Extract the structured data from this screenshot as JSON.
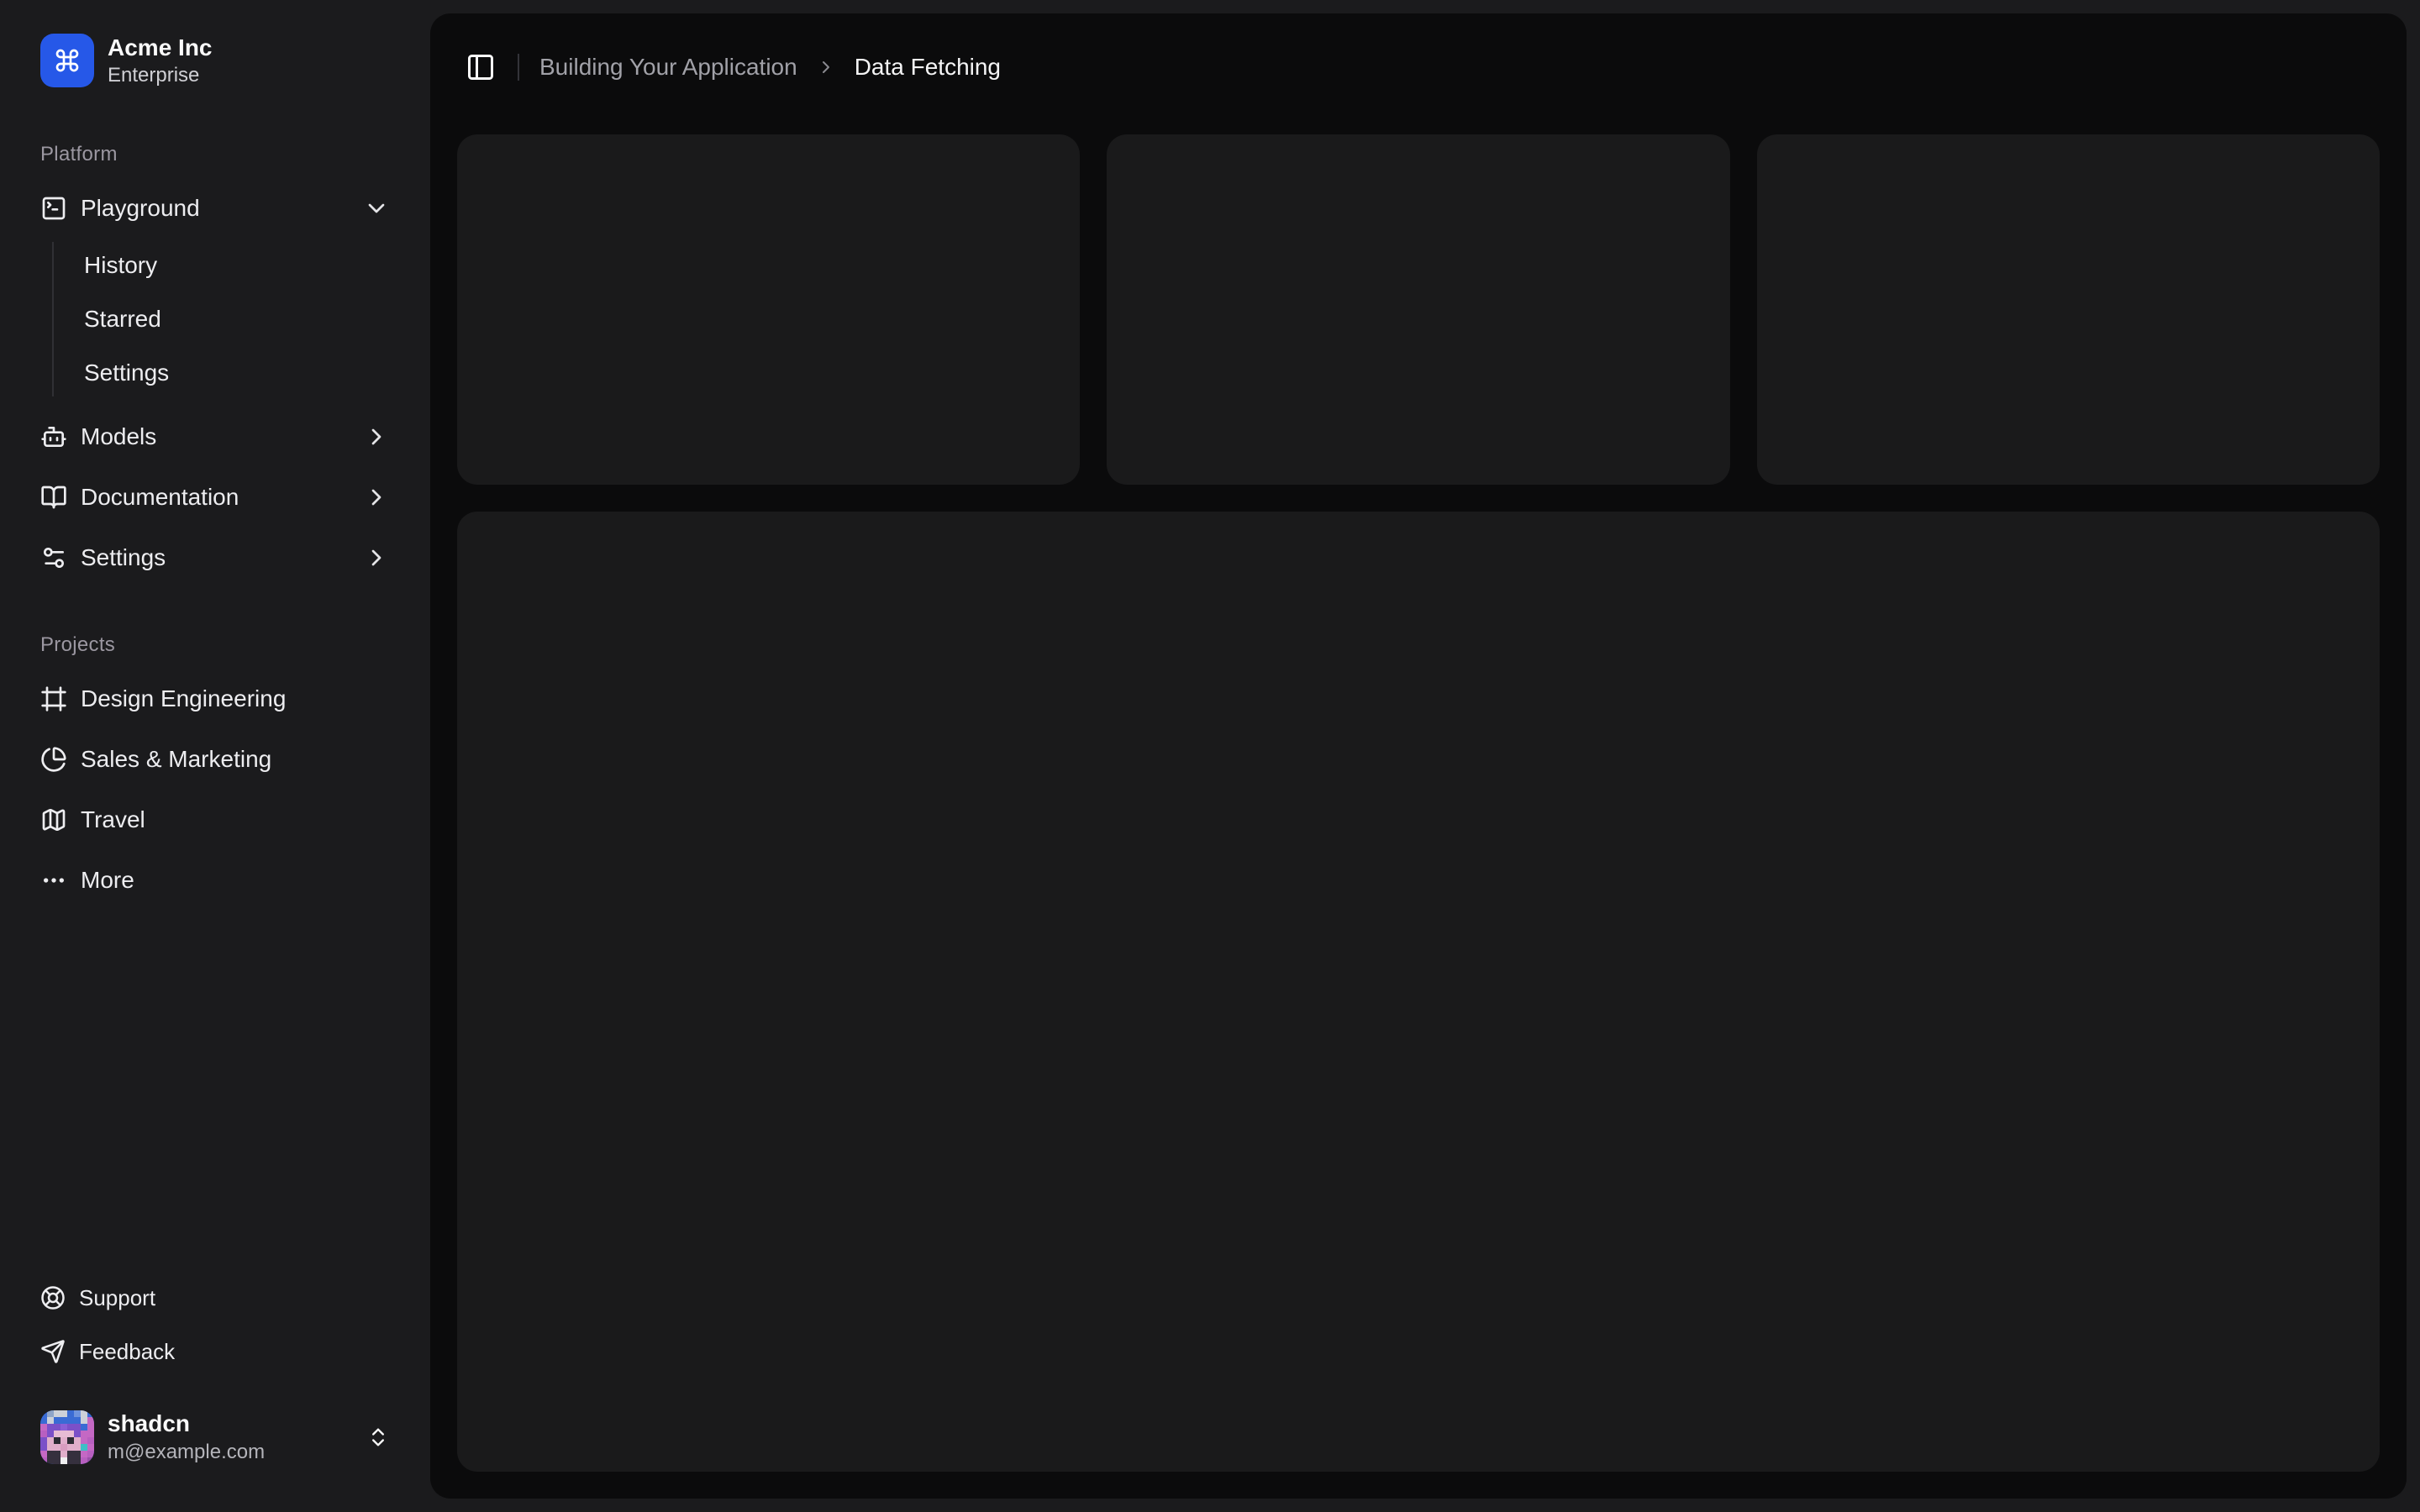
{
  "team": {
    "name": "Acme Inc",
    "plan": "Enterprise",
    "logo_icon": "command-icon",
    "logo_color": "#2658e8"
  },
  "sidebar": {
    "platform": {
      "label": "Platform",
      "playground": {
        "label": "Playground",
        "icon": "square-terminal-icon",
        "state": "expanded",
        "children": [
          {
            "label": "History"
          },
          {
            "label": "Starred"
          },
          {
            "label": "Settings"
          }
        ]
      },
      "items": [
        {
          "label": "Models",
          "icon": "bot-icon"
        },
        {
          "label": "Documentation",
          "icon": "book-open-icon"
        },
        {
          "label": "Settings",
          "icon": "settings-sliders-icon"
        }
      ]
    },
    "projects": {
      "label": "Projects",
      "items": [
        {
          "label": "Design Engineering",
          "icon": "frame-icon"
        },
        {
          "label": "Sales & Marketing",
          "icon": "pie-chart-icon"
        },
        {
          "label": "Travel",
          "icon": "map-icon"
        },
        {
          "label": "More",
          "icon": "ellipsis-icon"
        }
      ]
    },
    "secondary": {
      "items": [
        {
          "label": "Support",
          "icon": "life-buoy-icon"
        },
        {
          "label": "Feedback",
          "icon": "send-icon"
        }
      ]
    },
    "user": {
      "name": "shadcn",
      "email": "m@example.com",
      "menu_icon": "chevrons-up-down-icon"
    }
  },
  "header": {
    "toggle_icon": "panel-left-icon",
    "breadcrumb": {
      "parent": "Building Your Application",
      "separator_icon": "chevron-right-icon",
      "current": "Data Fetching"
    }
  },
  "colors": {
    "page_bg": "#1b1b1d",
    "panel_bg": "#0b0b0c",
    "card_bg": "#1a1a1b",
    "accent_blue": "#2658e8",
    "text_primary": "#fafafa",
    "text_muted": "#9b97a1"
  }
}
